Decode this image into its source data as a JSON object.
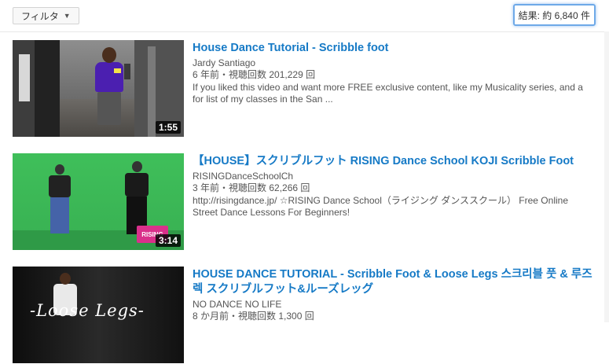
{
  "toolbar": {
    "filter_label": "フィルタ",
    "results_count": "結果: 約 6,840 件"
  },
  "results": [
    {
      "title": "House Dance Tutorial - Scribble foot",
      "channel": "Jardy Santiago",
      "age": "6 年前",
      "views": "視聴回数 201,229 回",
      "description": "If you liked this video and want more FREE exclusive content, like my Musicality series, and a for list of my classes in the San ...",
      "duration": "1:55"
    },
    {
      "title": "【HOUSE】スクリブルフット RISING Dance School KOJI Scribble Foot",
      "channel": "RISINGDanceSchoolCh",
      "age": "3 年前",
      "views": "視聴回数 62,266 回",
      "description": "http://risingdance.jp/ ☆RISING Dance School（ライジング ダンススクール） Free Online Street Dance Lessons For Beginners!",
      "duration": "3:14",
      "thumb_logo": "RISING"
    },
    {
      "title": "HOUSE DANCE TUTORIAL - Scribble Foot & Loose Legs 스크리블 풋 & 루즈 렉 スクリブルフット&ルーズレッグ",
      "channel": "NO DANCE NO LIFE",
      "age": "8 か月前",
      "views": "視聴回数 1,300 回",
      "thumb_text": "-Loose Legs-"
    }
  ],
  "meta_separator": "・",
  "colors": {
    "link_blue": "#167ac6",
    "highlight_border": "#6ea9e8"
  }
}
